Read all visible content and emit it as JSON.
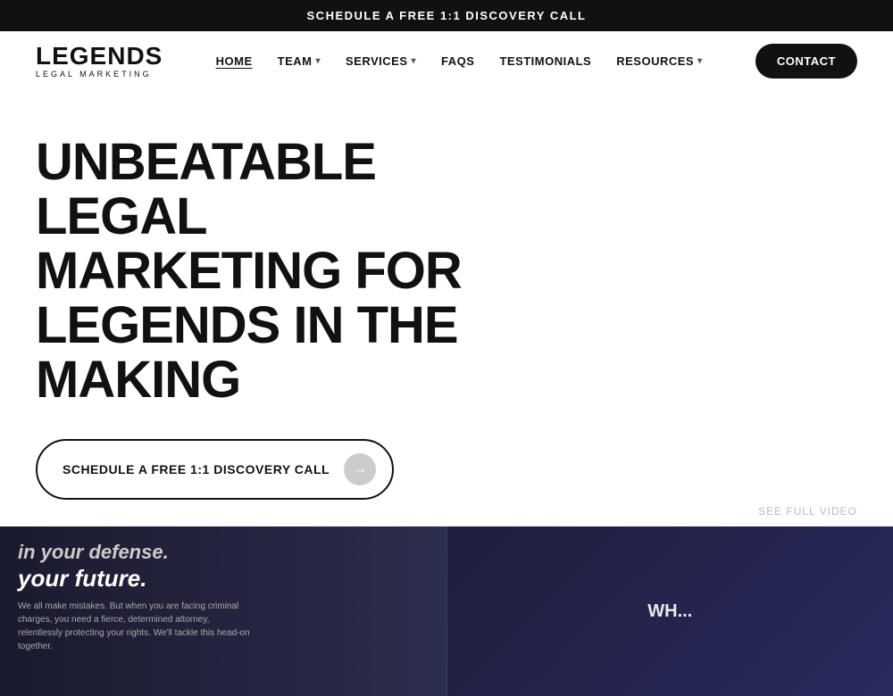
{
  "banner": {
    "text": "SCHEDULE A FREE 1:1 DISCOVERY CALL"
  },
  "header": {
    "logo": {
      "main": "LEGENDS",
      "sub": "LEGAL MARKETING"
    },
    "nav": [
      {
        "label": "HOME",
        "active": true,
        "hasDropdown": false
      },
      {
        "label": "TEAM",
        "active": false,
        "hasDropdown": true
      },
      {
        "label": "SERVICES",
        "active": false,
        "hasDropdown": true
      },
      {
        "label": "FAQS",
        "active": false,
        "hasDropdown": false
      },
      {
        "label": "TESTIMONIALS",
        "active": false,
        "hasDropdown": false
      },
      {
        "label": "RESOURCES",
        "active": false,
        "hasDropdown": true
      }
    ],
    "contact_button": "CONTACT"
  },
  "hero": {
    "title": "UNBEATABLE LEGAL MARKETING FOR LEGENDS IN THE MAKING",
    "cta_button": "SCHEDULE A FREE 1:1 DISCOVERY CALL",
    "see_full_video": "SEE FULL VIDEO"
  },
  "bottom": {
    "left_line1": "in your defense.",
    "left_line2": "your future.",
    "left_body": "We all make mistakes. But when you are facing criminal charges, you need a fierce, determined attorney, relentlessly protecting your rights. We'll tackle this head-on together.",
    "right_label": "Wh..."
  }
}
